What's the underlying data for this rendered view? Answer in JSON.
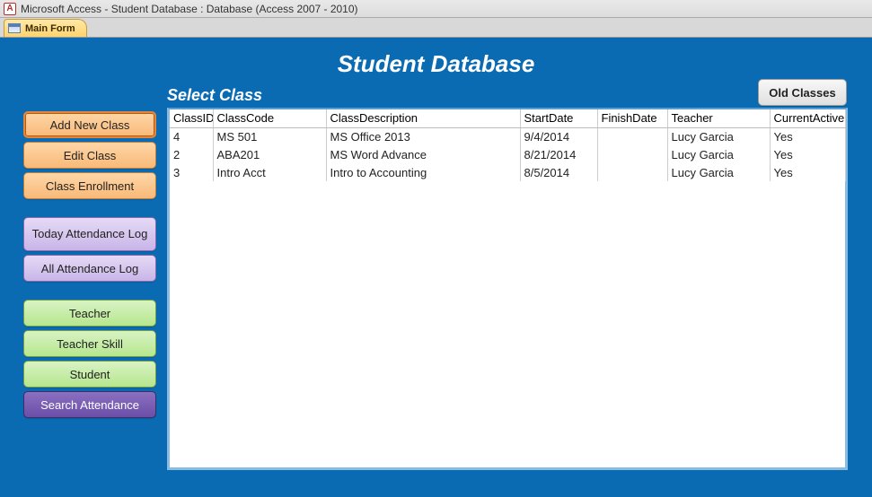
{
  "window": {
    "title": "Microsoft Access - Student Database : Database (Access 2007 - 2010)",
    "app_icon_letter": "A"
  },
  "tab": {
    "label": "Main Form"
  },
  "header": {
    "title": "Student Database"
  },
  "section": {
    "label": "Select Class"
  },
  "buttons": {
    "old_classes": "Old Classes",
    "add_new_class": "Add New Class",
    "edit_class": "Edit Class",
    "class_enrollment": "Class Enrollment",
    "today_attendance_log": "Today Attendance Log",
    "all_attendance_log": "All Attendance Log",
    "teacher": "Teacher",
    "teacher_skill": "Teacher Skill",
    "student": "Student",
    "search_attendance": "Search Attendance"
  },
  "grid": {
    "columns": {
      "class_id": "ClassID",
      "class_code": "ClassCode",
      "class_description": "ClassDescription",
      "start_date": "StartDate",
      "finish_date": "FinishDate",
      "teacher": "Teacher",
      "current_active": "CurrentActive"
    },
    "rows": [
      {
        "class_id": "4",
        "class_code": "MS 501",
        "class_description": "MS Office 2013",
        "start_date": "9/4/2014",
        "finish_date": "",
        "teacher": "Lucy Garcia",
        "current_active": "Yes"
      },
      {
        "class_id": "2",
        "class_code": "ABA201",
        "class_description": "MS Word Advance",
        "start_date": "8/21/2014",
        "finish_date": "",
        "teacher": "Lucy Garcia",
        "current_active": "Yes"
      },
      {
        "class_id": "3",
        "class_code": "Intro Acct",
        "class_description": "Intro to Accounting",
        "start_date": "8/5/2014",
        "finish_date": "",
        "teacher": "Lucy Garcia",
        "current_active": "Yes"
      }
    ]
  }
}
